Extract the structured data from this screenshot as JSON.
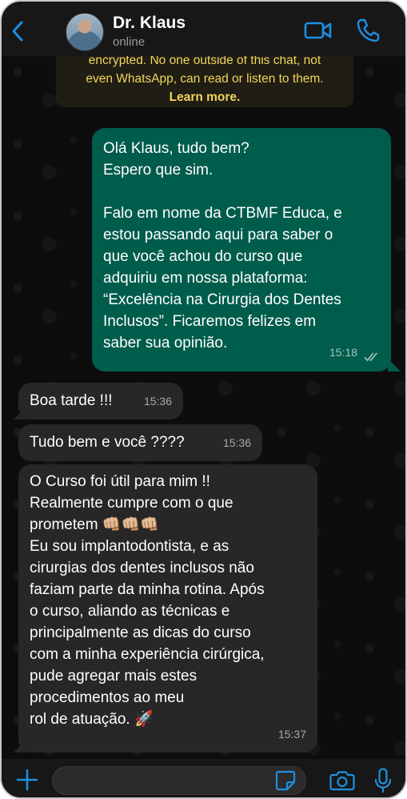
{
  "header": {
    "contact_name": "Dr. Klaus",
    "status": "online",
    "back_icon": "chevron-left-icon",
    "video_icon": "video-camera-icon",
    "call_icon": "phone-icon"
  },
  "encryption_note": {
    "line1": "encrypted. No one outside of this chat, not",
    "line2": "even WhatsApp, can read or listen to them.",
    "learn_more": "Learn more."
  },
  "messages": [
    {
      "direction": "outgoing",
      "lines": [
        "Olá Klaus, tudo bem?",
        "Espero que sim.",
        "",
        "Falo em nome da CTBMF Educa, e",
        "estou passando aqui para saber o",
        "que você achou do curso que",
        "adquiriu em nossa plataforma:",
        "“Excelência na Cirurgia dos Dentes",
        "Inclusos”. Ficaremos felizes em",
        "saber sua opinião."
      ],
      "time": "15:18",
      "status": "read"
    },
    {
      "direction": "incoming",
      "lines": [
        "Boa tarde !!!"
      ],
      "time": "15:36"
    },
    {
      "direction": "incoming",
      "lines": [
        "Tudo bem e você ????"
      ],
      "time": "15:36"
    },
    {
      "direction": "incoming",
      "lines": [
        "O Curso foi útil para mim !!",
        "Realmente cumpre com o que",
        "prometem 👊🏼👊🏼👊🏼",
        "Eu sou implantodontista, e as",
        "cirurgias dos dentes inclusos não",
        "faziam parte da minha rotina. Após",
        "o curso, aliando as técnicas e",
        "principalmente as dicas do curso",
        "com a minha experiência cirúrgica,",
        "pude agregar mais estes",
        "procedimentos ao meu",
        "rol de atuação. 🚀"
      ],
      "time": "15:37"
    }
  ],
  "footer": {
    "input_placeholder": "",
    "plus_icon": "plus-icon",
    "sticker_icon": "sticker-icon",
    "camera_icon": "camera-icon",
    "mic_icon": "microphone-icon"
  },
  "colors": {
    "accent": "#1d8fe1",
    "outgoing_bubble": "#005c4b",
    "incoming_bubble": "#272727",
    "notice_text": "#f2d55a"
  }
}
